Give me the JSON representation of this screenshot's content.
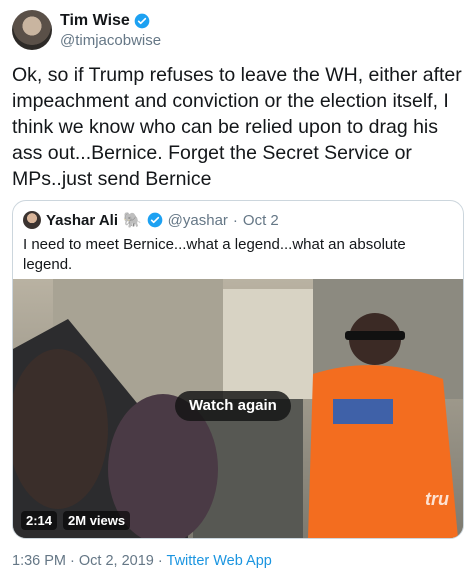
{
  "tweet": {
    "author_name": "Tim Wise",
    "author_handle": "@timjacobwise",
    "text": "Ok, so if Trump refuses to leave the WH, either after impeachment and conviction or the election itself, I think we know who can be relied upon to drag his ass out...Bernice. Forget the Secret Service or MPs..just send Bernice",
    "verified_icon": "verified-badge-icon",
    "colors": {
      "accent": "#1da1f2",
      "muted": "#657786",
      "link": "#1b95e0"
    }
  },
  "quoted": {
    "author_name": "Yashar Ali",
    "emoji": "🐘",
    "handle": "@yashar",
    "separator": "·",
    "date": "Oct 2",
    "text": "I need to meet Bernice...what a legend...what an absolute legend.",
    "video": {
      "button_label": "Watch again",
      "duration": "2:14",
      "views": "2M views",
      "watermark": "tru"
    }
  },
  "footer": {
    "time": "1:36 PM",
    "sep1": "·",
    "date": "Oct 2, 2019",
    "sep2": "·",
    "source": "Twitter Web App"
  }
}
